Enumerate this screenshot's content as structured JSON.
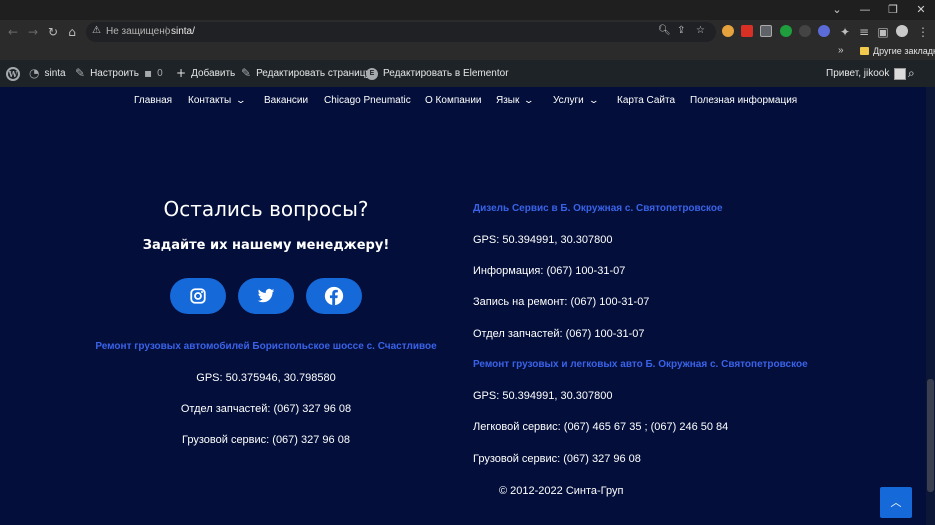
{
  "browser": {
    "address_warning": "Не защищено",
    "address_separator": "|",
    "url": "sinta/",
    "bookmarks_more": "»",
    "bookmarks_folder": "Другие закладки",
    "colors": {
      "frame": "#1f1f1f",
      "toolbar": "#2b2b2b"
    }
  },
  "adminbar": {
    "site_name": "sinta",
    "customize": "Настроить",
    "comments_count": "0",
    "add_new": "Добавить",
    "edit_page": "Редактировать страницу",
    "edit_elementor": "Редактировать в Elementor",
    "greeting": "Привет, jikook"
  },
  "nav": {
    "items": [
      {
        "label": "Главная"
      },
      {
        "label": "Контакты"
      },
      {
        "label": "Вакансии"
      },
      {
        "label": "Chicago Pneumatic"
      },
      {
        "label": "О Компании"
      },
      {
        "label": "Язык"
      },
      {
        "label": "Услуги"
      },
      {
        "label": "Карта Сайта"
      },
      {
        "label": "Полезная информация"
      }
    ]
  },
  "contact": {
    "headline": "Остались вопросы?",
    "subline": "Задайте их нашему менеджеру!",
    "social": [
      "instagram-icon",
      "twitter-icon",
      "facebook-icon"
    ],
    "left": {
      "heading": "Ремонт грузовых автомобилей Бориспольское шоссе с. Счастливое",
      "lines": [
        "GPS:   50.375946, 30.798580",
        "Отдел запчастей: (067) 327 96 08",
        "Грузовой сервис:   (067) 327 96 08"
      ]
    },
    "right": {
      "heading1": "Дизель Сервис в Б. Окружная с. Святопетровское",
      "lines1": [
        "GPS:   50.394991, 30.307800",
        "Информация:   (067) 100-31-07",
        "Запись на ремонт:   (067) 100-31-07",
        "Отдел запчастей:   (067) 100-31-07"
      ],
      "heading2": "Ремонт грузовых и легковых авто Б. Окружная с. Святопетровское",
      "lines2": [
        "GPS:   50.394991, 30.307800",
        "Легковой сервис:   (067) 465 67 35 ; (067) 246 50 84",
        "Грузовой сервис:   (067) 327 96 08"
      ]
    },
    "copyright": "© 2012-2022 Синта-Груп"
  },
  "colors": {
    "background": "#030f3a",
    "accent": "#1569d8",
    "link": "#3a62e8"
  }
}
